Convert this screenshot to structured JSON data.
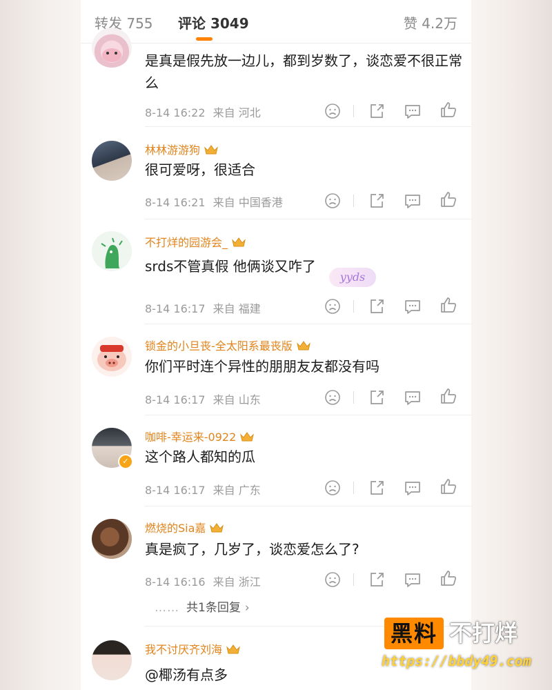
{
  "tabs": {
    "repost": "转发 755",
    "comments": "评论 3049",
    "likes": "赞 4.2万"
  },
  "comments": [
    {
      "username": "",
      "text": "是真是假先放一边儿，都到岁数了，谈恋爱不很正常么",
      "time": "8-14 16:22",
      "location": "来自 河北"
    },
    {
      "username": "林林游游狗",
      "text": "很可爱呀，很适合",
      "time": "8-14 16:21",
      "location": "来自 中国香港"
    },
    {
      "username": "不打烊的园游会_",
      "text": "srds不管真假 他俩谈又咋了",
      "sticker": "yyds",
      "time": "8-14 16:17",
      "location": "来自 福建"
    },
    {
      "username": "锁金的小旦丧-全太阳系最丧版",
      "text": "你们平时连个异性的朋朋友友都没有吗",
      "time": "8-14 16:17",
      "location": "来自 山东"
    },
    {
      "username": "咖啡-幸运来-0922",
      "text": "这个路人都知的瓜",
      "time": "8-14 16:17",
      "location": "来自 广东"
    },
    {
      "username": "燃烧的Sia嘉",
      "text": "真是疯了，几岁了，谈恋爱怎么了?",
      "time": "8-14 16:16",
      "location": "来自 浙江",
      "replies": "共1条回复"
    },
    {
      "username": "我不讨厌齐刘海",
      "text": "@椰汤有点多"
    }
  ],
  "watermark": {
    "brand": "黑料",
    "slogan": "不打烊",
    "url": "https://bbdy49.com"
  },
  "colors": {
    "accent": "#ff8200",
    "username": "#e2841b",
    "meta": "#9a9a9a"
  },
  "icons": [
    "sad-face-icon",
    "repost-icon",
    "comment-icon",
    "like-icon",
    "crown-icon",
    "verified-icon",
    "chevron-right-icon"
  ]
}
